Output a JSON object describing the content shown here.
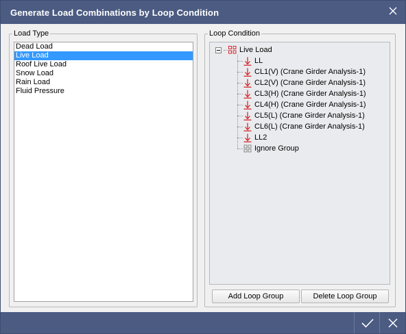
{
  "window": {
    "title": "Generate Load Combinations by Loop Condition",
    "close_icon": "close-icon"
  },
  "load_type": {
    "legend": "Load Type",
    "items": [
      {
        "label": "Dead Load",
        "selected": false
      },
      {
        "label": "Live Load",
        "selected": true
      },
      {
        "label": "Roof Live Load",
        "selected": false
      },
      {
        "label": "Snow Load",
        "selected": false
      },
      {
        "label": "Rain Load",
        "selected": false
      },
      {
        "label": "Fluid Pressure",
        "selected": false
      }
    ]
  },
  "loop_condition": {
    "legend": "Loop Condition",
    "root": {
      "label": "Live Load",
      "expander": "minus",
      "icon": "group-icon"
    },
    "children": [
      {
        "label": "LL",
        "icon": "load-arrow-icon"
      },
      {
        "label": "CL1(V) (Crane Girder Analysis-1)",
        "icon": "load-arrow-icon"
      },
      {
        "label": "CL2(V) (Crane Girder Analysis-1)",
        "icon": "load-arrow-icon"
      },
      {
        "label": "CL3(H) (Crane Girder Analysis-1)",
        "icon": "load-arrow-icon"
      },
      {
        "label": "CL4(H) (Crane Girder Analysis-1)",
        "icon": "load-arrow-icon"
      },
      {
        "label": "CL5(L) (Crane Girder Analysis-1)",
        "icon": "load-arrow-icon"
      },
      {
        "label": "CL6(L) (Crane Girder Analysis-1)",
        "icon": "load-arrow-icon"
      },
      {
        "label": "LL2",
        "icon": "load-arrow-icon"
      },
      {
        "label": "Ignore Group",
        "icon": "ignore-group-icon"
      }
    ],
    "add_button": "Add Loop Group",
    "delete_button": "Delete Loop Group"
  },
  "footer": {
    "ok_icon": "checkmark-icon",
    "cancel_icon": "close-icon"
  },
  "colors": {
    "titlebar": "#4b5b82",
    "selection": "#3399ff",
    "load_icon": "#d9262c"
  }
}
